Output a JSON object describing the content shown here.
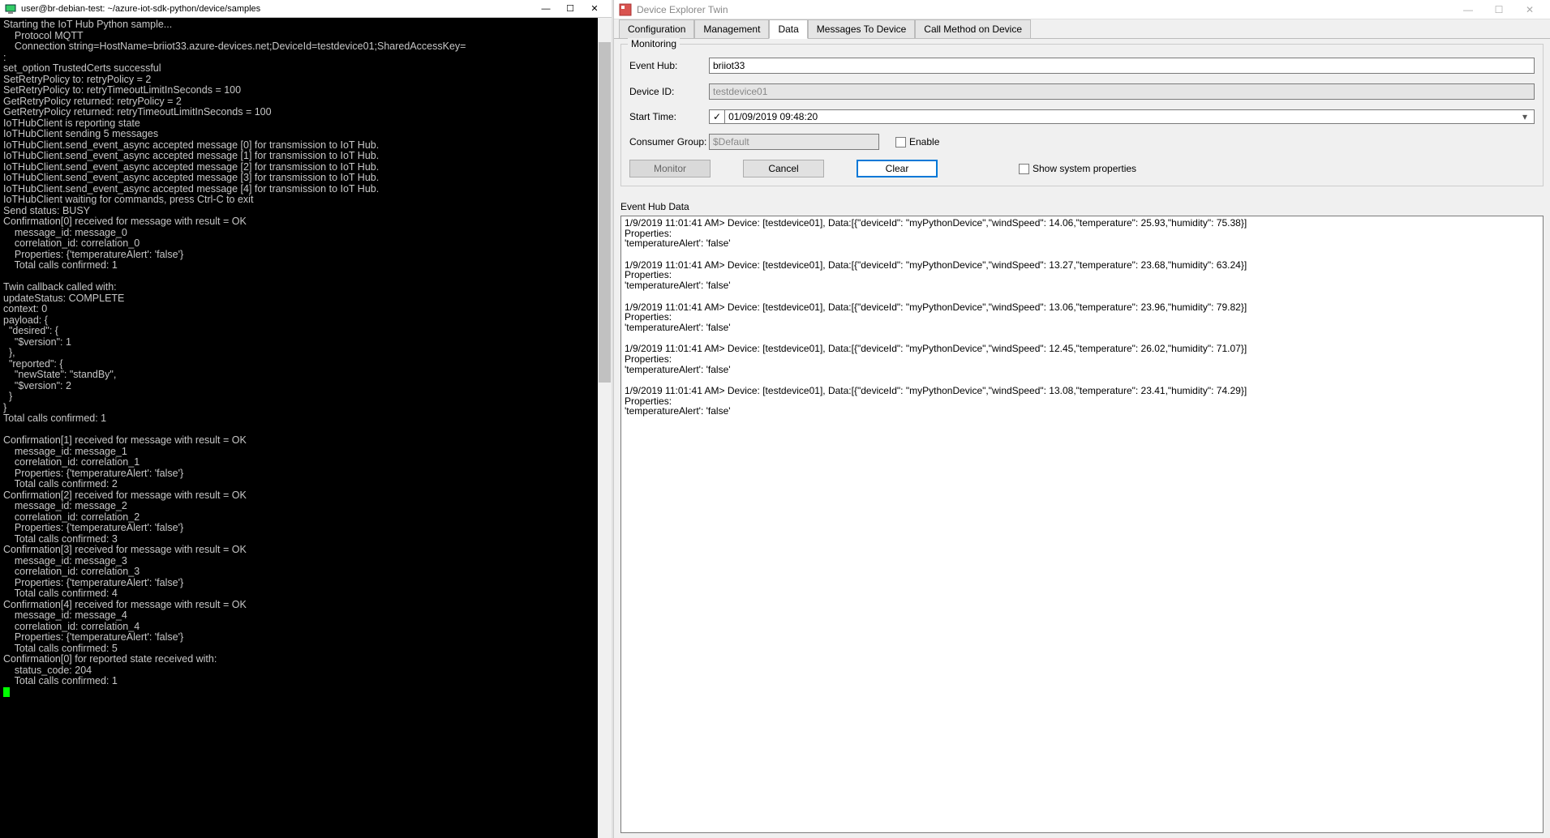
{
  "terminal": {
    "title": "user@br-debian-test: ~/azure-iot-sdk-python/device/samples",
    "lines": "Starting the IoT Hub Python sample...\n    Protocol MQTT\n    Connection string=HostName=briiot33.azure-devices.net;DeviceId=testdevice01;SharedAccessKey=\n:\nset_option TrustedCerts successful\nSetRetryPolicy to: retryPolicy = 2\nSetRetryPolicy to: retryTimeoutLimitInSeconds = 100\nGetRetryPolicy returned: retryPolicy = 2\nGetRetryPolicy returned: retryTimeoutLimitInSeconds = 100\nIoTHubClient is reporting state\nIoTHubClient sending 5 messages\nIoTHubClient.send_event_async accepted message [0] for transmission to IoT Hub.\nIoTHubClient.send_event_async accepted message [1] for transmission to IoT Hub.\nIoTHubClient.send_event_async accepted message [2] for transmission to IoT Hub.\nIoTHubClient.send_event_async accepted message [3] for transmission to IoT Hub.\nIoTHubClient.send_event_async accepted message [4] for transmission to IoT Hub.\nIoTHubClient waiting for commands, press Ctrl-C to exit\nSend status: BUSY\nConfirmation[0] received for message with result = OK\n    message_id: message_0\n    correlation_id: correlation_0\n    Properties: {'temperatureAlert': 'false'}\n    Total calls confirmed: 1\n\nTwin callback called with:\nupdateStatus: COMPLETE\ncontext: 0\npayload: {\n  \"desired\": {\n    \"$version\": 1\n  },\n  \"reported\": {\n    \"newState\": \"standBy\",\n    \"$version\": 2\n  }\n}\nTotal calls confirmed: 1\n\nConfirmation[1] received for message with result = OK\n    message_id: message_1\n    correlation_id: correlation_1\n    Properties: {'temperatureAlert': 'false'}\n    Total calls confirmed: 2\nConfirmation[2] received for message with result = OK\n    message_id: message_2\n    correlation_id: correlation_2\n    Properties: {'temperatureAlert': 'false'}\n    Total calls confirmed: 3\nConfirmation[3] received for message with result = OK\n    message_id: message_3\n    correlation_id: correlation_3\n    Properties: {'temperatureAlert': 'false'}\n    Total calls confirmed: 4\nConfirmation[4] received for message with result = OK\n    message_id: message_4\n    correlation_id: correlation_4\n    Properties: {'temperatureAlert': 'false'}\n    Total calls confirmed: 5\nConfirmation[0] for reported state received with:\n    status_code: 204\n    Total calls confirmed: 1"
  },
  "explorer": {
    "title": "Device Explorer Twin",
    "tabs": {
      "configuration": "Configuration",
      "management": "Management",
      "data": "Data",
      "messages": "Messages To Device",
      "call": "Call Method on Device"
    },
    "monitoring": {
      "group_title": "Monitoring",
      "event_hub_label": "Event Hub:",
      "event_hub_value": "briiot33",
      "device_id_label": "Device ID:",
      "device_id_value": "testdevice01",
      "start_time_label": "Start Time:",
      "start_time_value": "01/09/2019 09:48:20",
      "consumer_group_label": "Consumer Group:",
      "consumer_group_value": "$Default",
      "enable_label": "Enable",
      "monitor_button": "Monitor",
      "cancel_button": "Cancel",
      "clear_button": "Clear",
      "show_system_label": "Show system properties"
    },
    "event_hub_data": {
      "label": "Event Hub Data",
      "messages": [
        "1/9/2019 11:01:41 AM> Device: [testdevice01], Data:[{\"deviceId\": \"myPythonDevice\",\"windSpeed\": 14.06,\"temperature\": 25.93,\"humidity\": 75.38}]\nProperties:\n'temperatureAlert': 'false'",
        "1/9/2019 11:01:41 AM> Device: [testdevice01], Data:[{\"deviceId\": \"myPythonDevice\",\"windSpeed\": 13.27,\"temperature\": 23.68,\"humidity\": 63.24}]\nProperties:\n'temperatureAlert': 'false'",
        "1/9/2019 11:01:41 AM> Device: [testdevice01], Data:[{\"deviceId\": \"myPythonDevice\",\"windSpeed\": 13.06,\"temperature\": 23.96,\"humidity\": 79.82}]\nProperties:\n'temperatureAlert': 'false'",
        "1/9/2019 11:01:41 AM> Device: [testdevice01], Data:[{\"deviceId\": \"myPythonDevice\",\"windSpeed\": 12.45,\"temperature\": 26.02,\"humidity\": 71.07}]\nProperties:\n'temperatureAlert': 'false'",
        "1/9/2019 11:01:41 AM> Device: [testdevice01], Data:[{\"deviceId\": \"myPythonDevice\",\"windSpeed\": 13.08,\"temperature\": 23.41,\"humidity\": 74.29}]\nProperties:\n'temperatureAlert': 'false'"
      ]
    }
  }
}
